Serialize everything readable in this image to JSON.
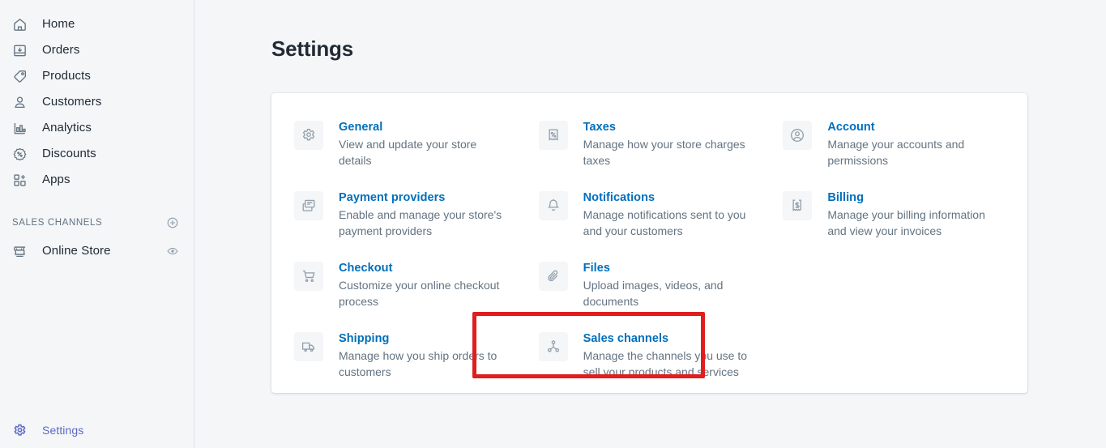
{
  "sidebar": {
    "nav_items": [
      {
        "label": "Home",
        "icon": "home-icon"
      },
      {
        "label": "Orders",
        "icon": "orders-icon"
      },
      {
        "label": "Products",
        "icon": "products-tag-icon"
      },
      {
        "label": "Customers",
        "icon": "customers-person-icon"
      },
      {
        "label": "Analytics",
        "icon": "analytics-bars-icon"
      },
      {
        "label": "Discounts",
        "icon": "discounts-percent-icon"
      },
      {
        "label": "Apps",
        "icon": "apps-grid-plus-icon"
      }
    ],
    "sales_channels": {
      "title": "SALES CHANNELS",
      "add_icon": "plus-circle-icon",
      "items": [
        {
          "label": "Online Store",
          "icon": "store-icon",
          "action_icon": "eye-icon"
        }
      ]
    },
    "footer": {
      "label": "Settings",
      "icon": "gear-icon",
      "active_color": "#5c6ac4"
    }
  },
  "main": {
    "page_title": "Settings",
    "settings": [
      {
        "title": "General",
        "desc": "View and update your store details",
        "icon": "gear-icon",
        "highlighted": false
      },
      {
        "title": "Taxes",
        "desc": "Manage how your store charges taxes",
        "icon": "tax-receipt-percent-icon",
        "highlighted": false
      },
      {
        "title": "Account",
        "desc": "Manage your accounts and permissions",
        "icon": "account-circle-person-icon",
        "highlighted": false
      },
      {
        "title": "Payment providers",
        "desc": "Enable and manage your store's payment providers",
        "icon": "payment-cards-icon",
        "highlighted": false
      },
      {
        "title": "Notifications",
        "desc": "Manage notifications sent to you and your customers",
        "icon": "bell-icon",
        "highlighted": false
      },
      {
        "title": "Billing",
        "desc": "Manage your billing information and view your invoices",
        "icon": "billing-dollar-receipt-icon",
        "highlighted": false
      },
      {
        "title": "Checkout",
        "desc": "Customize your online checkout process",
        "icon": "shopping-cart-icon",
        "highlighted": false
      },
      {
        "title": "Files",
        "desc": "Upload images, videos, and documents",
        "icon": "paperclip-icon",
        "highlighted": false
      },
      {
        "title": "",
        "desc": "",
        "icon": "",
        "highlighted": false
      },
      {
        "title": "Shipping",
        "desc": "Manage how you ship orders to customers",
        "icon": "delivery-truck-icon",
        "highlighted": true
      },
      {
        "title": "Sales channels",
        "desc": "Manage the channels you use to sell your products and services",
        "icon": "sales-channels-node-icon",
        "highlighted": false
      },
      {
        "title": "",
        "desc": "",
        "icon": "",
        "highlighted": false
      }
    ]
  },
  "colors": {
    "link": "#006fbb",
    "text": "#212b36",
    "muted": "#637381",
    "bg": "#f4f6f8",
    "highlight_red": "#e01e1e",
    "accent_indigo": "#5c6ac4"
  }
}
